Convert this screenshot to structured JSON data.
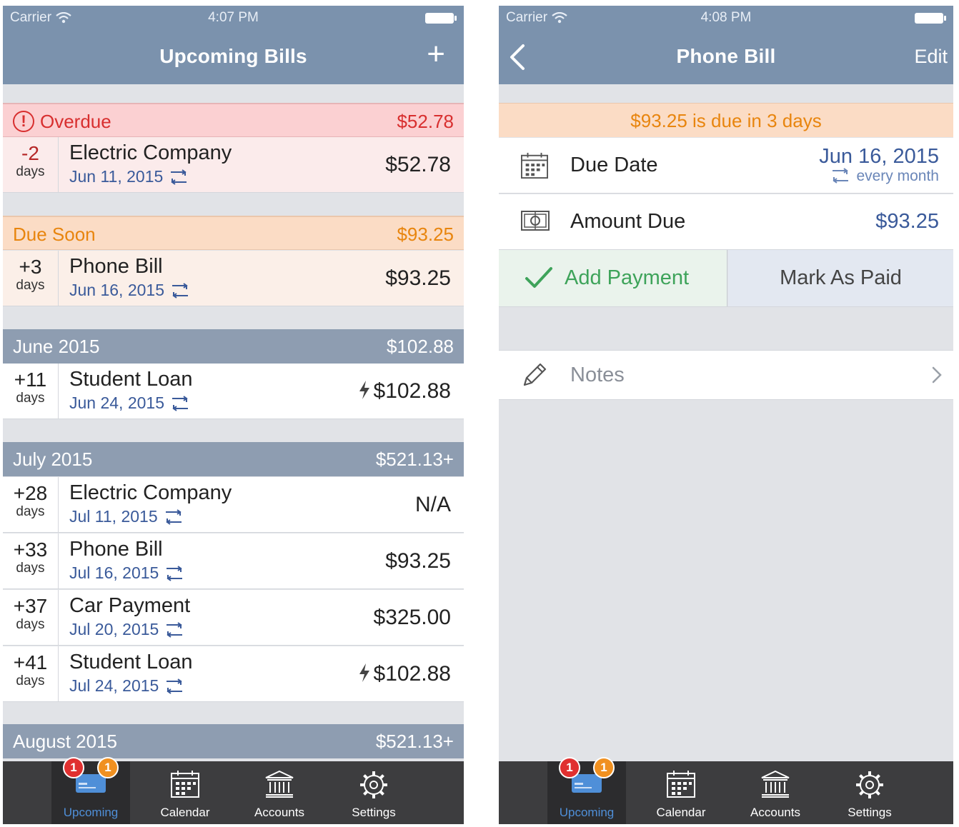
{
  "left": {
    "status": {
      "carrier": "Carrier",
      "time": "4:07 PM"
    },
    "nav": {
      "title": "Upcoming Bills",
      "add_label": "+"
    },
    "sections": {
      "overdue": {
        "title": "Overdue",
        "total": "$52.78",
        "alert": "!"
      },
      "due_soon": {
        "title": "Due Soon",
        "total": "$93.25"
      },
      "june": {
        "title": "June 2015",
        "total": "$102.88"
      },
      "july": {
        "title": "July 2015",
        "total": "$521.13+"
      },
      "august": {
        "title": "August 2015",
        "total": "$521.13+"
      }
    },
    "bills": [
      {
        "days": "-2",
        "days_label": "days",
        "name": "Electric Company",
        "date": "Jun 11, 2015",
        "amount": "$52.78"
      },
      {
        "days": "+3",
        "days_label": "days",
        "name": "Phone Bill",
        "date": "Jun 16, 2015",
        "amount": "$93.25"
      },
      {
        "days": "+11",
        "days_label": "days",
        "name": "Student Loan",
        "date": "Jun 24, 2015",
        "amount": "$102.88"
      },
      {
        "days": "+28",
        "days_label": "days",
        "name": "Electric Company",
        "date": "Jul 11, 2015",
        "amount": "N/A"
      },
      {
        "days": "+33",
        "days_label": "days",
        "name": "Phone Bill",
        "date": "Jul 16, 2015",
        "amount": "$93.25"
      },
      {
        "days": "+37",
        "days_label": "days",
        "name": "Car Payment",
        "date": "Jul 20, 2015",
        "amount": "$325.00"
      },
      {
        "days": "+41",
        "days_label": "days",
        "name": "Student Loan",
        "date": "Jul 24, 2015",
        "amount": "$102.88"
      }
    ]
  },
  "right": {
    "status": {
      "carrier": "Carrier",
      "time": "4:08 PM"
    },
    "nav": {
      "title": "Phone Bill",
      "edit_label": "Edit"
    },
    "banner": "$93.25 is due in 3 days",
    "due_date": {
      "label": "Due Date",
      "value": "Jun 16, 2015",
      "repeat": "every month"
    },
    "amount_due": {
      "label": "Amount Due",
      "value": "$93.25"
    },
    "actions": {
      "add_payment": "Add Payment",
      "mark_paid": "Mark As Paid"
    },
    "notes": {
      "label": "Notes"
    }
  },
  "tabbar": {
    "tabs": [
      {
        "label": "Upcoming",
        "icon": "bill-card-icon"
      },
      {
        "label": "Calendar",
        "icon": "calendar-icon"
      },
      {
        "label": "Accounts",
        "icon": "bank-icon"
      },
      {
        "label": "Settings",
        "icon": "gear-icon"
      }
    ],
    "badge_overdue": "1",
    "badge_due_soon": "1"
  },
  "colors": {
    "nav_bar": "#7b92ad",
    "overdue": "#d82f2f",
    "due_soon": "#e8850e",
    "month_header": "#8e9db1",
    "link_blue": "#3a5a9a",
    "add_payment_green": "#3ea35a",
    "tab_active": "#4f8fd8"
  }
}
